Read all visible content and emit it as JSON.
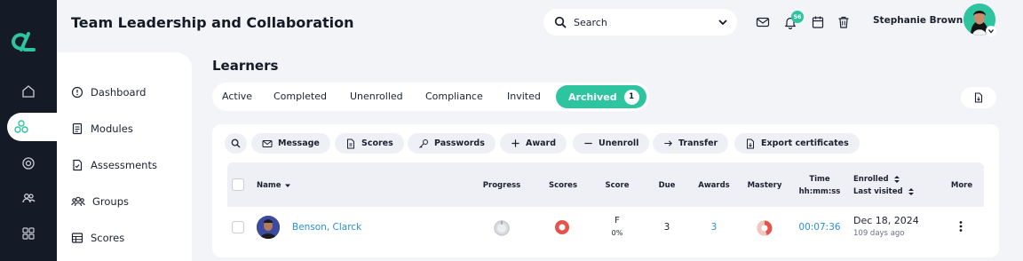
{
  "header": {
    "title": "Team Leadership and Collaboration",
    "search_placeholder": "Search",
    "notification_count": "56",
    "user_name": "Stephanie Brown"
  },
  "rail": {
    "icons": [
      "home-icon",
      "learning-icon",
      "target-icon",
      "people-icon",
      "apps-icon"
    ]
  },
  "sidebar": {
    "items": [
      {
        "label": "Dashboard",
        "icon": "dashboard-icon"
      },
      {
        "label": "Modules",
        "icon": "modules-icon"
      },
      {
        "label": "Assessments",
        "icon": "assessments-icon"
      },
      {
        "label": "Groups",
        "icon": "groups-icon"
      },
      {
        "label": "Scores",
        "icon": "scores-icon"
      }
    ]
  },
  "learners": {
    "title": "Learners",
    "tabs": [
      "Active",
      "Completed",
      "Unenrolled",
      "Compliance",
      "Invited"
    ],
    "active_tab": {
      "label": "Archived",
      "count": "1"
    },
    "toolbar": [
      "Message",
      "Scores",
      "Passwords",
      "Award",
      "Unenroll",
      "Transfer",
      "Export certificates"
    ]
  },
  "table": {
    "headers": {
      "name": "Name",
      "progress": "Progress",
      "scores": "Scores",
      "score": "Score",
      "due": "Due",
      "awards": "Awards",
      "mastery": "Mastery",
      "time_line1": "Time",
      "time_line2": "hh:mm:ss",
      "enrolled": "Enrolled",
      "last_visited": "Last visited",
      "more": "More"
    },
    "rows": [
      {
        "name": "Benson, Clarck",
        "progress": 0,
        "score_grade": "F",
        "score_pct": "0%",
        "due": "3",
        "awards": "3",
        "mastery": 0.45,
        "time": "00:07:36",
        "enrolled_date": "Dec 18, 2024",
        "last_visited": "109 days ago"
      }
    ]
  },
  "colors": {
    "accent": "#2ec4a0",
    "rail": "#141a26",
    "link": "#2a8fd8",
    "danger": "#e5534b"
  }
}
